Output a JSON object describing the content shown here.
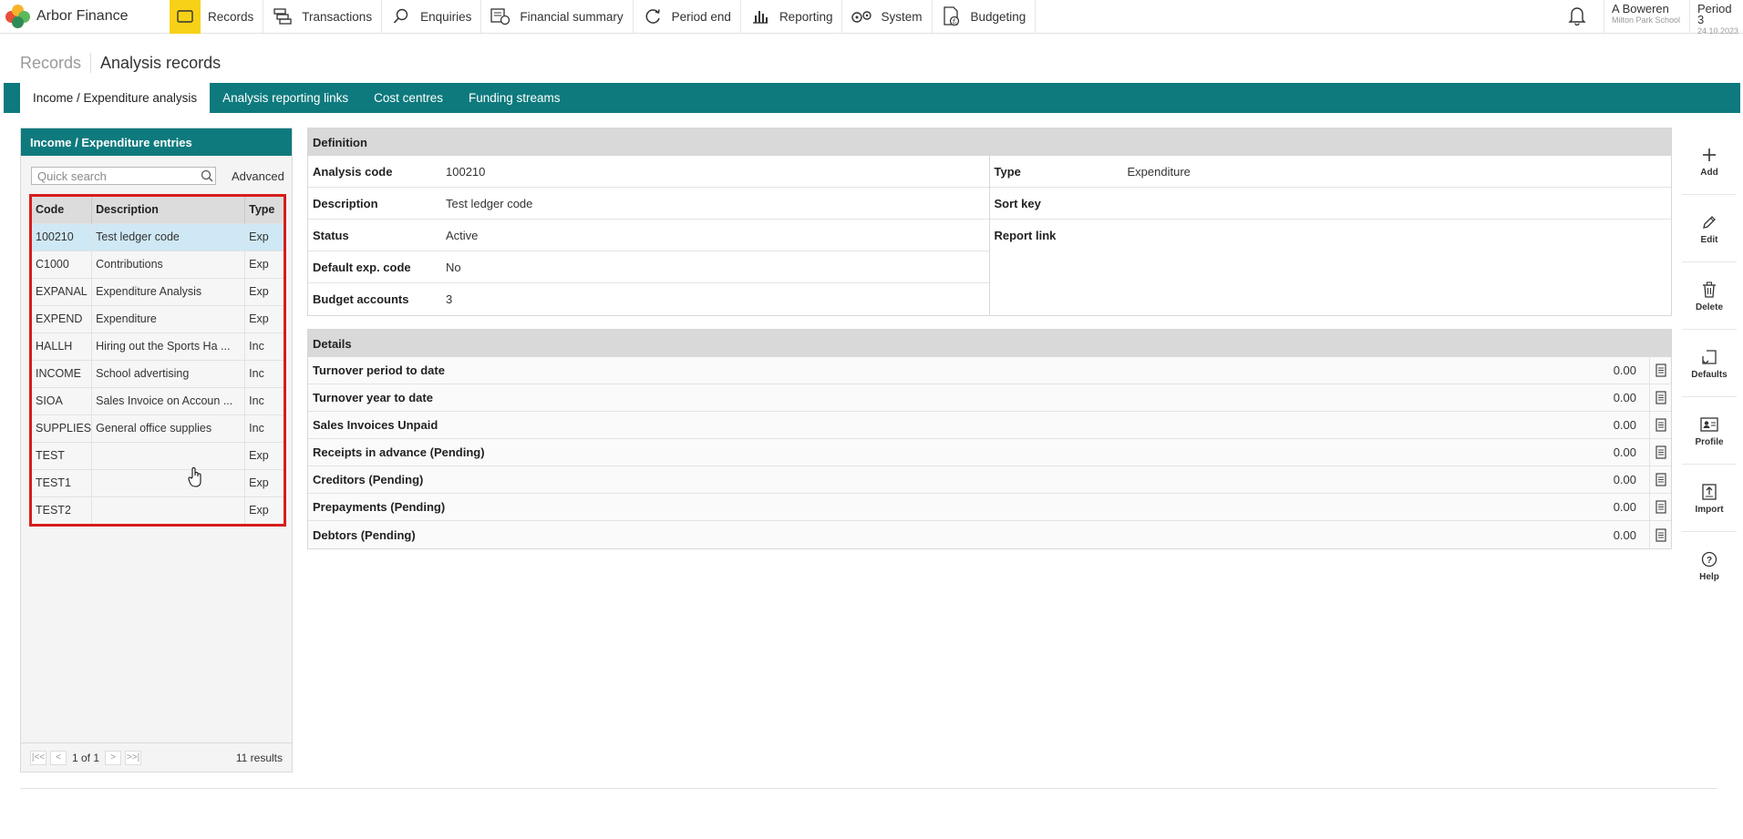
{
  "app": {
    "name": "Arbor Finance",
    "logo_colors": [
      "#e94f37",
      "#f7b32b",
      "#5cb85c",
      "#2e8b57"
    ]
  },
  "nav": {
    "items": [
      {
        "label": "Records",
        "icon": "records-icon",
        "active": true
      },
      {
        "label": "Transactions",
        "icon": "transactions-icon"
      },
      {
        "label": "Enquiries",
        "icon": "search-icon"
      },
      {
        "label": "Financial summary",
        "icon": "financial-summary-icon"
      },
      {
        "label": "Period end",
        "icon": "period-end-icon"
      },
      {
        "label": "Reporting",
        "icon": "reporting-icon"
      },
      {
        "label": "System",
        "icon": "system-icon"
      },
      {
        "label": "Budgeting",
        "icon": "budgeting-icon"
      }
    ]
  },
  "user": {
    "name": "A Boweren",
    "school": "Milton Park School"
  },
  "period": {
    "label": "Period 3",
    "date": "24.10.2023"
  },
  "breadcrumb": {
    "parent": "Records",
    "current": "Analysis records"
  },
  "tabs": [
    {
      "label": "Income / Expenditure analysis",
      "active": true
    },
    {
      "label": "Analysis reporting links"
    },
    {
      "label": "Cost centres"
    },
    {
      "label": "Funding streams"
    }
  ],
  "left_panel": {
    "title": "Income / Expenditure entries",
    "search_placeholder": "Quick search",
    "advanced_label": "Advanced",
    "columns": [
      "Code",
      "Description",
      "Type"
    ],
    "rows": [
      {
        "code": "100210",
        "description": "Test ledger code",
        "type": "Exp",
        "selected": true
      },
      {
        "code": "C1000",
        "description": "Contributions",
        "type": "Exp"
      },
      {
        "code": "EXPANAL",
        "description": "Expenditure Analysis",
        "type": "Exp"
      },
      {
        "code": "EXPEND",
        "description": "Expenditure",
        "type": "Exp"
      },
      {
        "code": "HALLH",
        "description": "Hiring out the Sports Ha ...",
        "type": "Inc"
      },
      {
        "code": "INCOME",
        "description": "School advertising",
        "type": "Inc"
      },
      {
        "code": "SIOA",
        "description": "Sales Invoice on Accoun ...",
        "type": "Inc"
      },
      {
        "code": "SUPPLIES",
        "description": "General office supplies",
        "type": "Inc"
      },
      {
        "code": "TEST",
        "description": "",
        "type": "Exp"
      },
      {
        "code": "TEST1",
        "description": "",
        "type": "Exp"
      },
      {
        "code": "TEST2",
        "description": "",
        "type": "Exp"
      }
    ],
    "pager": {
      "info": "1 of 1",
      "results": "11 results"
    }
  },
  "definition": {
    "title": "Definition",
    "left": [
      {
        "label": "Analysis code",
        "value": "100210"
      },
      {
        "label": "Description",
        "value": "Test ledger code"
      },
      {
        "label": "Status",
        "value": "Active"
      },
      {
        "label": "Default exp. code",
        "value": "No"
      },
      {
        "label": "Budget accounts",
        "value": "3"
      }
    ],
    "right": [
      {
        "label": "Type",
        "value": "Expenditure"
      },
      {
        "label": "Sort key",
        "value": ""
      },
      {
        "label": "Report link",
        "value": ""
      }
    ]
  },
  "details": {
    "title": "Details",
    "rows": [
      {
        "label": "Turnover period to date",
        "value": "0.00"
      },
      {
        "label": "Turnover year to date",
        "value": "0.00"
      },
      {
        "label": "Sales Invoices Unpaid",
        "value": "0.00"
      },
      {
        "label": "Receipts in advance (Pending)",
        "value": "0.00"
      },
      {
        "label": "Creditors (Pending)",
        "value": "0.00"
      },
      {
        "label": "Prepayments (Pending)",
        "value": "0.00"
      },
      {
        "label": "Debtors (Pending)",
        "value": "0.00"
      }
    ]
  },
  "actions": [
    {
      "label": "Add",
      "icon": "plus-icon"
    },
    {
      "label": "Edit",
      "icon": "pencil-icon"
    },
    {
      "label": "Delete",
      "icon": "trash-icon"
    },
    {
      "label": "Defaults",
      "icon": "defaults-icon"
    },
    {
      "label": "Profile",
      "icon": "profile-icon"
    },
    {
      "label": "Import",
      "icon": "import-icon"
    },
    {
      "label": "Help",
      "icon": "help-icon"
    }
  ],
  "colors": {
    "teal": "#0e7a7d",
    "active_nav": "#f7d117",
    "highlight_border": "#d81c1c",
    "selected_row": "#cfe8f5"
  }
}
